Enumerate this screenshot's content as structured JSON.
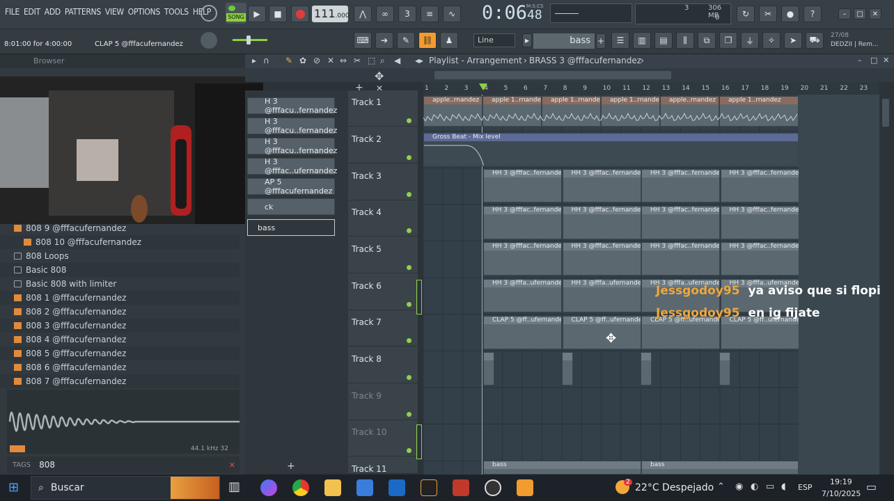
{
  "menu": [
    "FILE",
    "EDIT",
    "ADD",
    "PATTERNS",
    "VIEW",
    "OPTIONS",
    "TOOLS",
    "HELP"
  ],
  "transport": {
    "song_label": "SONG",
    "tempo": "111",
    "tempo_decimal": ".000",
    "time": "0:06",
    "time_sub": "48",
    "time_unit": "M:S:CS",
    "cpu": "3",
    "ram": "306 MB",
    "voices": "0"
  },
  "hint": {
    "left": "8:01:00 for 4:00:00",
    "right": "CLAP 5 @fffacufernandez"
  },
  "toolbar2": {
    "snap": "Line",
    "pattern": "bass",
    "news_date": "27/08",
    "news_text": "DEDZII | Rem..."
  },
  "browser": {
    "title": "Browser",
    "items": [
      {
        "label": "808 9 @fffacufernandez",
        "type": "sample"
      },
      {
        "label": "808 10 @fffacufernandez",
        "type": "sample"
      },
      {
        "label": "808 Loops",
        "type": "folder"
      },
      {
        "label": "Basic 808",
        "type": "folder"
      },
      {
        "label": "Basic 808 with limiter",
        "type": "folder"
      },
      {
        "label": "808 1 @fffacufernandez",
        "type": "sample"
      },
      {
        "label": "808 2 @fffacufernandez",
        "type": "sample"
      },
      {
        "label": "808 3 @fffacufernandez",
        "type": "sample"
      },
      {
        "label": "808 4 @fffacufernandez",
        "type": "sample"
      },
      {
        "label": "808 5 @fffacufernandez",
        "type": "sample"
      },
      {
        "label": "808 6 @fffacufernandez",
        "type": "sample"
      },
      {
        "label": "808 7 @fffacufernandez",
        "type": "sample"
      }
    ],
    "sample_info": "44.1 kHz 32",
    "tags_label": "TAGS",
    "search_value": "808"
  },
  "picker": [
    "H 3 @fffacu..fernandez",
    "H 3 @fffacu..fernandez",
    "H 3 @fffacu..fernandez",
    "H 3 @fffac..ufernandez",
    "AP 5 @fffacufernandez",
    "ck",
    "bass"
  ],
  "playlist": {
    "title": "Playlist - Arrangement",
    "pattern": "BRASS 3 @fffacufernandez",
    "ruler": [
      "1",
      "2",
      "3",
      "4",
      "5",
      "6",
      "7",
      "8",
      "9",
      "10",
      "11",
      "12",
      "13",
      "14",
      "15",
      "16",
      "17",
      "18",
      "19",
      "20",
      "21",
      "22",
      "23"
    ],
    "tracks": [
      "Track 1",
      "Track 2",
      "Track 3",
      "Track 4",
      "Track 5",
      "Track 6",
      "Track 7",
      "Track 8",
      "Track 9",
      "Track 10",
      "Track 11"
    ],
    "clip_apple_a": "apple..rnandez",
    "clip_apple_b": "apple 1..rnandez",
    "clip_gross": "Gross Beat - Mix level",
    "clip_hh": "HH 3 @fffac..fernandez",
    "clip_hh6": "HH 3 @fffa..ufernandez",
    "clip_clap": "CLAP 5 @ff..ufernandez",
    "clip_bass": "bass"
  },
  "chat": [
    {
      "user": "Jessgodoy95",
      "msg": "ya aviso que si flopi"
    },
    {
      "user": "Jessgodoy95",
      "msg": "en ig fijate"
    }
  ],
  "taskbar": {
    "search_placeholder": "Buscar",
    "weather": "22°C  Despejado",
    "weather_badge": "2",
    "lang": "ESP",
    "time": "19:19",
    "date": "7/10/2025"
  },
  "colors": {
    "accent": "#f29b2e",
    "chat_user": "#f0a63a",
    "clip": "#5b6870",
    "green": "#8fd14f"
  }
}
